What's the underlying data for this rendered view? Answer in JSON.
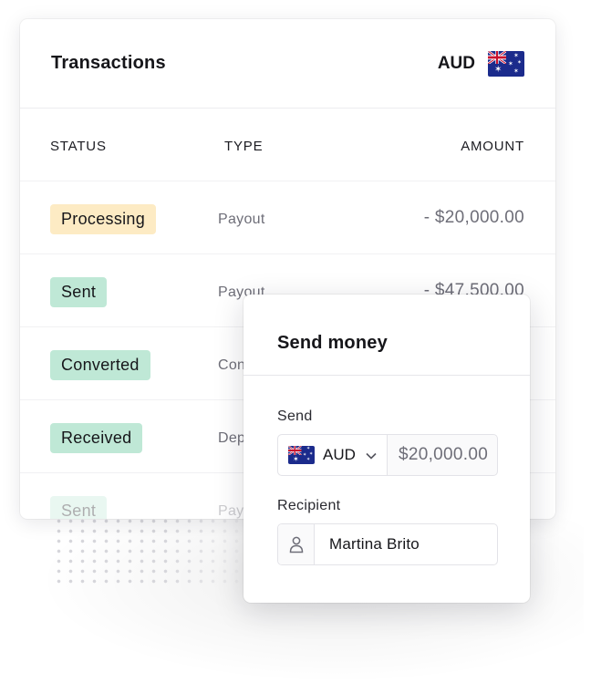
{
  "transactions": {
    "title": "Transactions",
    "currency": {
      "code": "AUD",
      "flag_icon": "australia-flag-icon"
    },
    "columns": {
      "status": "STATUS",
      "type": "TYPE",
      "amount": "AMOUNT"
    },
    "rows": [
      {
        "status": "Processing",
        "status_color": "#fdebc4",
        "type": "Payout",
        "amount": "- $20,000.00"
      },
      {
        "status": "Sent",
        "status_color": "#bfe8d6",
        "type": "Payout",
        "amount": "- $47,500.00"
      },
      {
        "status": "Converted",
        "status_color": "#bfe8d6",
        "type": "Con",
        "amount": ""
      },
      {
        "status": "Received",
        "status_color": "#bfe8d6",
        "type": "Dep",
        "amount": ""
      },
      {
        "status": "Sent",
        "status_color": "#bfe8d6",
        "type": "Pay",
        "amount": ""
      }
    ]
  },
  "send_money": {
    "title": "Send money",
    "send_label": "Send",
    "currency_code": "AUD",
    "currency_flag_icon": "australia-flag-icon",
    "dropdown_icon": "chevron-down-icon",
    "amount": "$20,000.00",
    "recipient_label": "Recipient",
    "recipient_icon": "person-icon",
    "recipient_name": "Martina Brito"
  },
  "colors": {
    "processing_badge": "#fdebc4",
    "success_badge": "#bfe8d6",
    "flag_blue": "#1b2b8c",
    "muted_text": "#6e6e78"
  }
}
